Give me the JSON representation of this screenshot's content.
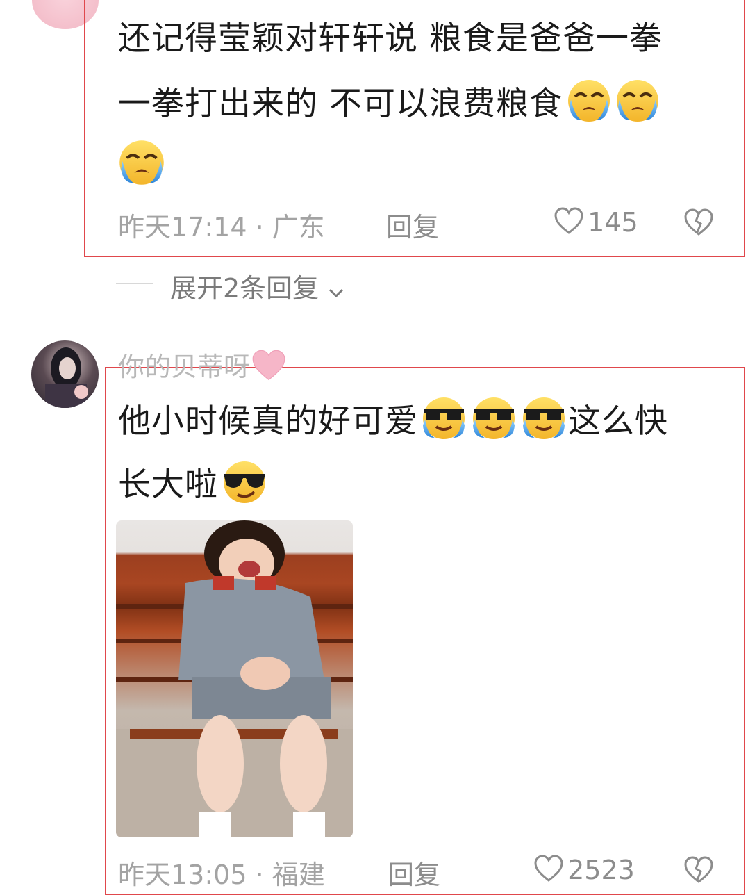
{
  "comment1": {
    "line1": "还记得莹颖对轩轩说 粮食是爸爸一拳",
    "line2": "一拳打出来的 不可以浪费粮食",
    "emojis": [
      "crying-face",
      "crying-face",
      "crying-face"
    ],
    "meta": "昨天17:14 · 广东",
    "reply_label": "回复",
    "likes": "145"
  },
  "expand_replies": "展开2条回复",
  "comment2": {
    "username": "你的贝蒂呀",
    "username_emoji": "pink-heart",
    "line1": "他小时候真的好可爱",
    "line1_tail": "这么快",
    "line2": "长大啦",
    "emojis": [
      "sunglasses-tears-face",
      "sunglasses-tears-face",
      "sunglasses-tears-face",
      "sunglasses-face"
    ],
    "image": "crying-child-photo",
    "meta": "昨天13:05 · 福建",
    "reply_label": "回复",
    "likes": "2523"
  },
  "colors": {
    "frame": "#e0474c",
    "meta": "#a3a3a3",
    "emoji_yellow": "#f7c63c",
    "tear_blue": "#4fa6e8"
  }
}
